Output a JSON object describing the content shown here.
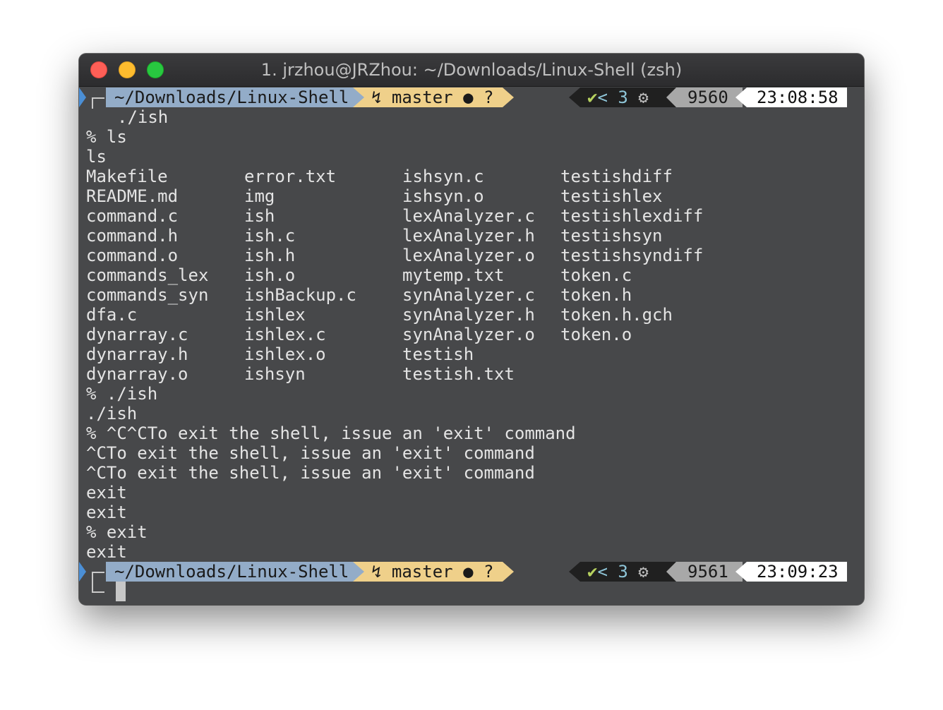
{
  "window": {
    "title": "1. jrzhou@JRZhou: ~/Downloads/Linux-Shell (zsh)"
  },
  "prompt1": {
    "dir": "~/Downloads/Linux-Shell",
    "branch_icon": "↯",
    "branch": "master",
    "git_status": "● ?",
    "check": "✔",
    "chevron": "<",
    "jobs": "3",
    "gear": "⚙",
    "history": "9560",
    "time": "23:08:58"
  },
  "prompt2": {
    "dir": "~/Downloads/Linux-Shell",
    "branch_icon": "↯",
    "branch": "master",
    "git_status": "● ?",
    "check": "✔",
    "chevron": "<",
    "jobs": "3",
    "gear": "⚙",
    "history": "9561",
    "time": "23:09:23"
  },
  "lines_before": [
    "./ish",
    "% ls",
    "ls"
  ],
  "ls_columns": [
    [
      "Makefile",
      "README.md",
      "command.c",
      "command.h",
      "command.o",
      "commands_lex",
      "commands_syn",
      "dfa.c",
      "dynarray.c",
      "dynarray.h",
      "dynarray.o"
    ],
    [
      "error.txt",
      "img",
      "ish",
      "ish.c",
      "ish.h",
      "ish.o",
      "ishBackup.c",
      "ishlex",
      "ishlex.c",
      "ishlex.o",
      "ishsyn"
    ],
    [
      "ishsyn.c",
      "ishsyn.o",
      "lexAnalyzer.c",
      "lexAnalyzer.h",
      "lexAnalyzer.o",
      "mytemp.txt",
      "synAnalyzer.c",
      "synAnalyzer.h",
      "synAnalyzer.o",
      "testish",
      "testish.txt"
    ],
    [
      "testishdiff",
      "testishlex",
      "testishlexdiff",
      "testishsyn",
      "testishsyndiff",
      "token.c",
      "token.h",
      "token.h.gch",
      "token.o"
    ]
  ],
  "lines_after": [
    "% ./ish",
    "./ish",
    "% ^C^CTo exit the shell, issue an 'exit' command",
    "^CTo exit the shell, issue an 'exit' command",
    "^CTo exit the shell, issue an 'exit' command",
    "exit",
    "exit",
    "% exit",
    "exit"
  ],
  "colors": {
    "terminal_bg": "#47484a",
    "dir_segment": "#93acc8",
    "git_segment": "#efd08a",
    "check_green": "#b6d15f"
  }
}
